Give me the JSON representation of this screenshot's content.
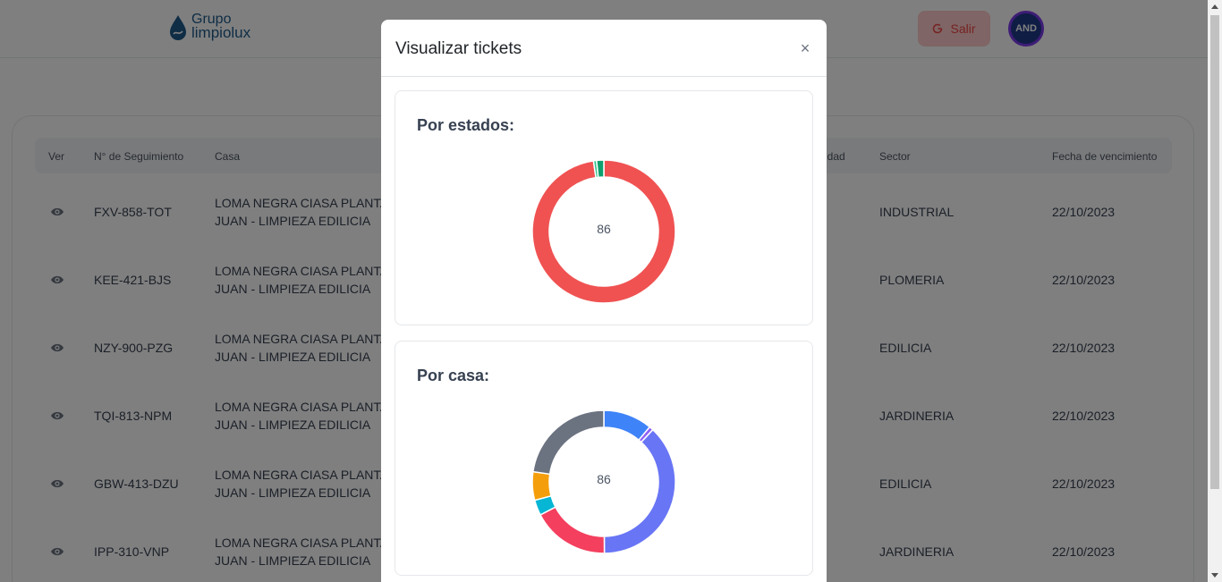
{
  "header": {
    "logo_line1": "Grupo",
    "logo_line2": "limpiolux",
    "exit_label": "Salir",
    "avatar_initials": "AND"
  },
  "table": {
    "columns": [
      "Ver",
      "N° de Seguimiento",
      "Casa",
      "ridad",
      "Sector",
      "Fecha de vencimiento"
    ],
    "rows": [
      {
        "tracking": "FXV-858-TOT",
        "house_line1": "LOMA NEGRA CIASA PLANTA",
        "house_line2": "JUAN - LIMPIEZA EDILICIA",
        "sector": "INDUSTRIAL",
        "due": "22/10/2023"
      },
      {
        "tracking": "KEE-421-BJS",
        "house_line1": "LOMA NEGRA CIASA PLANTA",
        "house_line2": "JUAN - LIMPIEZA EDILICIA",
        "sector": "PLOMERIA",
        "due": "22/10/2023"
      },
      {
        "tracking": "NZY-900-PZG",
        "house_line1": "LOMA NEGRA CIASA PLANTA",
        "house_line2": "JUAN - LIMPIEZA EDILICIA",
        "sector": "EDILICIA",
        "due": "22/10/2023"
      },
      {
        "tracking": "TQI-813-NPM",
        "house_line1": "LOMA NEGRA CIASA PLANTA",
        "house_line2": "JUAN - LIMPIEZA EDILICIA",
        "sector": "JARDINERIA",
        "due": "22/10/2023"
      },
      {
        "tracking": "GBW-413-DZU",
        "house_line1": "LOMA NEGRA CIASA PLANTA",
        "house_line2": "JUAN - LIMPIEZA EDILICIA",
        "sector": "EDILICIA",
        "due": "22/10/2023"
      },
      {
        "tracking": "IPP-310-VNP",
        "house_line1": "LOMA NEGRA CIASA PLANTA",
        "house_line2": "JUAN - LIMPIEZA EDILICIA",
        "sector": "JARDINERIA",
        "due": "22/10/2023"
      }
    ]
  },
  "modal": {
    "title": "Visualizar tickets",
    "close_label": "×"
  },
  "colors": {
    "exit_bg": "#fecaca",
    "exit_text": "#ef4444",
    "avatar_bg": "#1e3a8a",
    "avatar_ring": "#7c3aed"
  },
  "chart_data": [
    {
      "type": "pie",
      "title": "Por estados:",
      "center_label": "86",
      "values": [
        84,
        0.6,
        1.4
      ],
      "colors": [
        "#f05252",
        "#31c48d",
        "#0e9f6e"
      ]
    },
    {
      "type": "pie",
      "title": "Por casa:",
      "center_label": "86",
      "values": [
        9.5,
        0.8,
        32.5,
        15,
        3,
        5.5,
        19.5
      ],
      "colors": [
        "#3f83f8",
        "#9061f9",
        "#6875f5",
        "#f43f5e",
        "#06b6d4",
        "#f59e0b",
        "#6b7280"
      ]
    }
  ]
}
